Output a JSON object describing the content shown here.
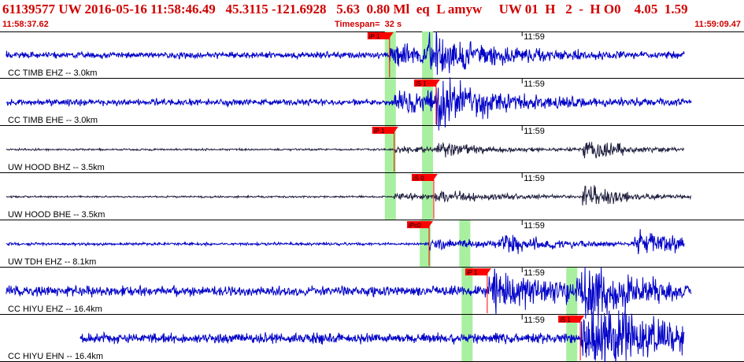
{
  "header": {
    "title": "61139577 UW 2016-05-16 11:58:46.49   45.3115 -121.6928   5.63  0.80 Ml  eq  L amyw     UW 01  H   2  -  H O0    4.05  1.59",
    "start_time": "11:58:37.62",
    "timespan": "Timespan=  32 s",
    "end_time": "11:59:09.47"
  },
  "time_axis": {
    "start_seconds": 37.62,
    "end_seconds": 69.47,
    "minute_mark_label": "11:59",
    "minute_mark_seconds": 60.0
  },
  "colors": {
    "header_text": "#d00000",
    "trace_blue": "#0000c8",
    "trace_black": "#202040",
    "pick_flag": "#ff0000",
    "pick_window": "#a8f0a0"
  },
  "channels": [
    {
      "label": "CC TIMB EHZ -- 3.0km",
      "color": "blue",
      "amp": 7,
      "p_arrival": 54.3,
      "s_arrival": 55.9,
      "picks": [
        {
          "label": "iP 1",
          "time": 54.3
        }
      ],
      "windows": [
        54.3,
        55.9
      ]
    },
    {
      "label": "CC TIMB EHE -- 3.0km",
      "color": "blue",
      "amp": 7,
      "p_arrival": 54.5,
      "s_arrival": 56.3,
      "picks": [
        {
          "label": "iS 1",
          "time": 56.3
        }
      ],
      "windows": [
        54.3,
        55.9
      ]
    },
    {
      "label": "UW HOOD BHZ -- 3.5km",
      "color": "black",
      "amp": 2,
      "p_arrival": 54.5,
      "s_arrival": 56.3,
      "picks": [
        {
          "label": "iP 1",
          "time": 54.5
        }
      ],
      "windows": [
        54.3,
        55.9
      ],
      "event2": 62.6
    },
    {
      "label": "UW HOOD BHE -- 3.5km",
      "color": "black",
      "amp": 2,
      "p_arrival": 54.5,
      "s_arrival": 56.2,
      "picks": [
        {
          "label": "iS 0",
          "time": 56.2
        }
      ],
      "windows": [
        54.3,
        55.9
      ],
      "event2": 62.6
    },
    {
      "label": "UW TDH EHZ -- 8.1km",
      "color": "blue",
      "amp": 3,
      "p_arrival": 56.0,
      "s_arrival": 59.0,
      "picks": [
        {
          "label": "iPc0",
          "time": 56.0
        }
      ],
      "windows": [
        55.8,
        57.5
      ],
      "event2": 64.8
    },
    {
      "label": "CC HIYU EHZ -- 16.4km",
      "color": "blue",
      "amp": 11,
      "p_arrival": 58.5,
      "s_arrival": 62.3,
      "picks": [
        {
          "label": "iP 1",
          "time": 58.5
        }
      ],
      "windows": [
        57.6,
        62.1
      ]
    },
    {
      "label": "CC HIYU EHN -- 16.4km",
      "color": "blue",
      "amp": 11,
      "p_arrival": 62.5,
      "s_arrival": 62.8,
      "picks": [
        {
          "label": "iS 1",
          "time": 62.5
        }
      ],
      "windows": [
        57.6,
        62.1
      ],
      "leading_gap": 41.0
    }
  ]
}
